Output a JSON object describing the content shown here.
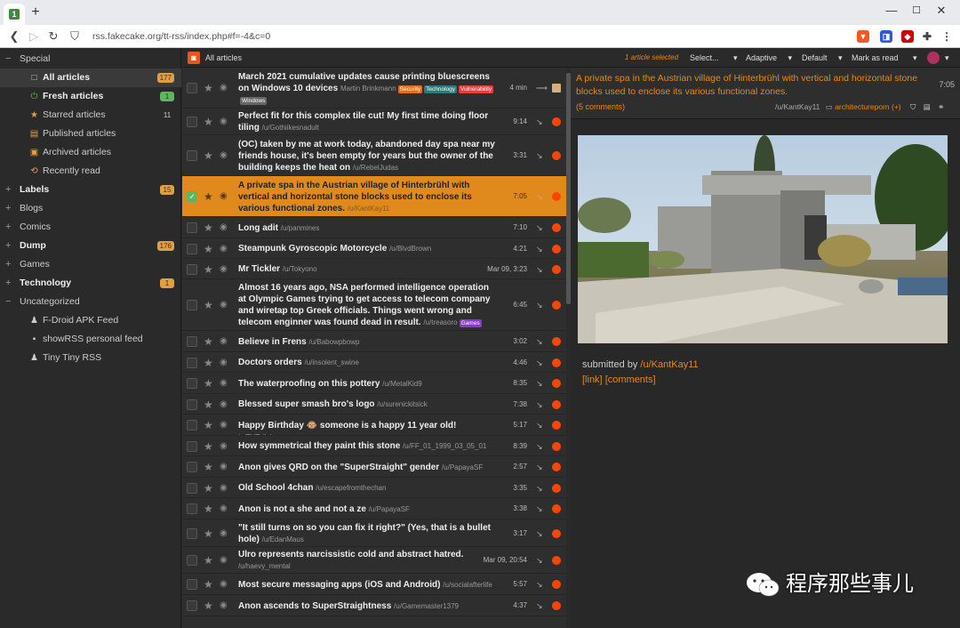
{
  "browser": {
    "url": "rss.fakecake.org/tt-rss/index.php#f=-4&c=0",
    "new_tab": "+",
    "min": "—",
    "max": "☐",
    "close": "✕"
  },
  "colors": {
    "accent": "#e08a1e",
    "reddit": "#ff4500"
  },
  "sidebar": {
    "items": [
      {
        "pm": "−",
        "label": "Special",
        "indent": 22,
        "cat": true
      },
      {
        "label": "All articles",
        "count": "177",
        "count_color": "#e0a040",
        "icon": "□",
        "bold": true,
        "selected": true
      },
      {
        "label": "Fresh articles",
        "count": "1",
        "count_color": "#5cb85c",
        "icon": "⏻",
        "bold": true
      },
      {
        "label": "Starred articles",
        "count": "11",
        "count_color": "transparent",
        "icon": "★"
      },
      {
        "label": "Published articles",
        "icon": "▤"
      },
      {
        "label": "Archived articles",
        "icon": "▣"
      },
      {
        "label": "Recently read",
        "icon": "⟲"
      },
      {
        "pm": "+",
        "label": "Labels",
        "count": "15",
        "count_color": "#e0a040",
        "indent": 22,
        "cat": true,
        "bold": true
      },
      {
        "pm": "+",
        "label": "Blogs",
        "indent": 22,
        "cat": true
      },
      {
        "pm": "+",
        "label": "Comics",
        "indent": 22,
        "cat": true
      },
      {
        "pm": "+",
        "label": "Dump",
        "count": "176",
        "count_color": "#e0a040",
        "indent": 22,
        "cat": true,
        "bold": true
      },
      {
        "pm": "+",
        "label": "Games",
        "indent": 22,
        "cat": true
      },
      {
        "pm": "+",
        "label": "Technology",
        "count": "1",
        "count_color": "#e0a040",
        "indent": 22,
        "cat": true,
        "bold": true
      },
      {
        "pm": "−",
        "label": "Uncategorized",
        "indent": 22,
        "cat": true
      },
      {
        "label": "F-Droid APK Feed",
        "icon": "♟"
      },
      {
        "label": "showRSS personal feed",
        "icon": "▪"
      },
      {
        "label": "Tiny Tiny RSS",
        "icon": "♟"
      }
    ]
  },
  "toolbar": {
    "feed_title": "All articles",
    "selected_info": "1 article selected",
    "select": "Select...",
    "adaptive": "Adaptive",
    "default": "Default",
    "mark_read": "Mark as read"
  },
  "articles": [
    {
      "title": "March 2021 cumulative updates cause printing bluescreens on Windows 10 devices",
      "author": "Martin Brinkmann",
      "tags": [
        {
          "t": "Security",
          "c": "#e07020"
        },
        {
          "t": "Technology",
          "c": "#2e7a7a"
        },
        {
          "t": "Vulnerability",
          "c": "#e04040"
        },
        {
          "t": "Windows",
          "c": "#666"
        }
      ],
      "time": "4 min",
      "h": 46
    },
    {
      "title": "Perfect fit for this complex tile cut! My first time doing floor tiling",
      "author": "/u/Gothiikesnadult",
      "time": "9:14",
      "h": 30
    },
    {
      "title": "(OC) taken by me at work today, abandoned day spa near my friends house, it's been empty for years but the owner of the building keeps the heat on",
      "author": "/u/RebelJudas",
      "time": "3:31",
      "h": 46
    },
    {
      "title": "A private spa in the Austrian village of Hinterbrühl with vertical and horizontal stone blocks used to enclose its various functional zones.",
      "author": "/u/KantKay11",
      "time": "7:05",
      "h": 46,
      "selected": true
    },
    {
      "title": "Long adit",
      "author": "/u/panmines",
      "time": "7:10",
      "h": 24
    },
    {
      "title": "Steampunk Gyroscopic Motorcycle",
      "author": "/u/BlvdBrown",
      "time": "4:21",
      "h": 23
    },
    {
      "title": "Mr Tickler",
      "author": "/u/Tokyono",
      "time": "Mar 09, 3:23",
      "h": 23
    },
    {
      "title": "Almost 16 years ago, NSA performed intelligence operation at Olympic Games trying to get access to telecom company and wiretap top Greek officials. Things went wrong and telecom enginner was found dead in result.",
      "author": "/u/treasoro",
      "tags": [
        {
          "t": "Games",
          "c": "#8a3ad0"
        }
      ],
      "time": "6:45",
      "h": 58
    },
    {
      "title": "Believe in Frens",
      "author": "/u/Babowpbowp",
      "time": "3:02",
      "h": 24
    },
    {
      "title": "Doctors orders",
      "author": "/u/insolent_swine",
      "time": "4:46",
      "h": 23
    },
    {
      "title": "The waterproofing on this pottery",
      "author": "/u/MetalKid9",
      "time": "8:35",
      "h": 24
    },
    {
      "title": "Blessed super smash bro's logo",
      "author": "/u/surenickitsick",
      "time": "7:38",
      "h": 23
    },
    {
      "title": "Happy Birthday 🐵 someone is a happy 11 year old!",
      "author": "/u/TUTelicious",
      "time": "5:17",
      "h": 24
    },
    {
      "title": "How symmetrical they paint this stone",
      "author": "/u/FF_01_1999_03_05_01",
      "time": "8:39",
      "h": 23
    },
    {
      "title": "Anon gives QRD on the \"SuperStraight\" gender",
      "author": "/u/PapayaSF",
      "time": "2:57",
      "h": 24
    },
    {
      "title": "Old School 4chan",
      "author": "/u/escapefromthechan",
      "time": "3:35",
      "h": 23
    },
    {
      "title": "Anon is not a she and not a ze",
      "author": "/u/PapayaSF",
      "time": "3:38",
      "h": 24
    },
    {
      "title": "\"It still turns on so you can fix it right?\" (Yes, that is a bullet hole)",
      "author": "/u/EdanMaus",
      "time": "3:17",
      "h": 31
    },
    {
      "title": "Ulro represents narcissistic cold and abstract hatred.",
      "author": "/u/haevy_mental",
      "time": "Mar 09, 20:54",
      "h": 30
    },
    {
      "title": "Most secure messaging apps (iOS and Android)",
      "author": "/u/socialafterlife",
      "time": "5:57",
      "h": 24
    },
    {
      "title": "Anon ascends to SuperStraightness",
      "author": "/u/Gamemaster1379",
      "time": "4:37",
      "h": 24
    }
  ],
  "reader": {
    "title": "A private spa in the Austrian village of Hinterbrühl with vertical and horizontal stone blocks used to enclose its various functional zones.",
    "time": "7:05",
    "comments": "(5 comments)",
    "author": "/u/KantKay11",
    "feed": "architectureporn (+)",
    "submitted": "submitted by ",
    "submitted_user": "/u/KantKay11",
    "link": "[link]",
    "comments_link": "[comments]"
  },
  "watermark": "程序那些事儿"
}
